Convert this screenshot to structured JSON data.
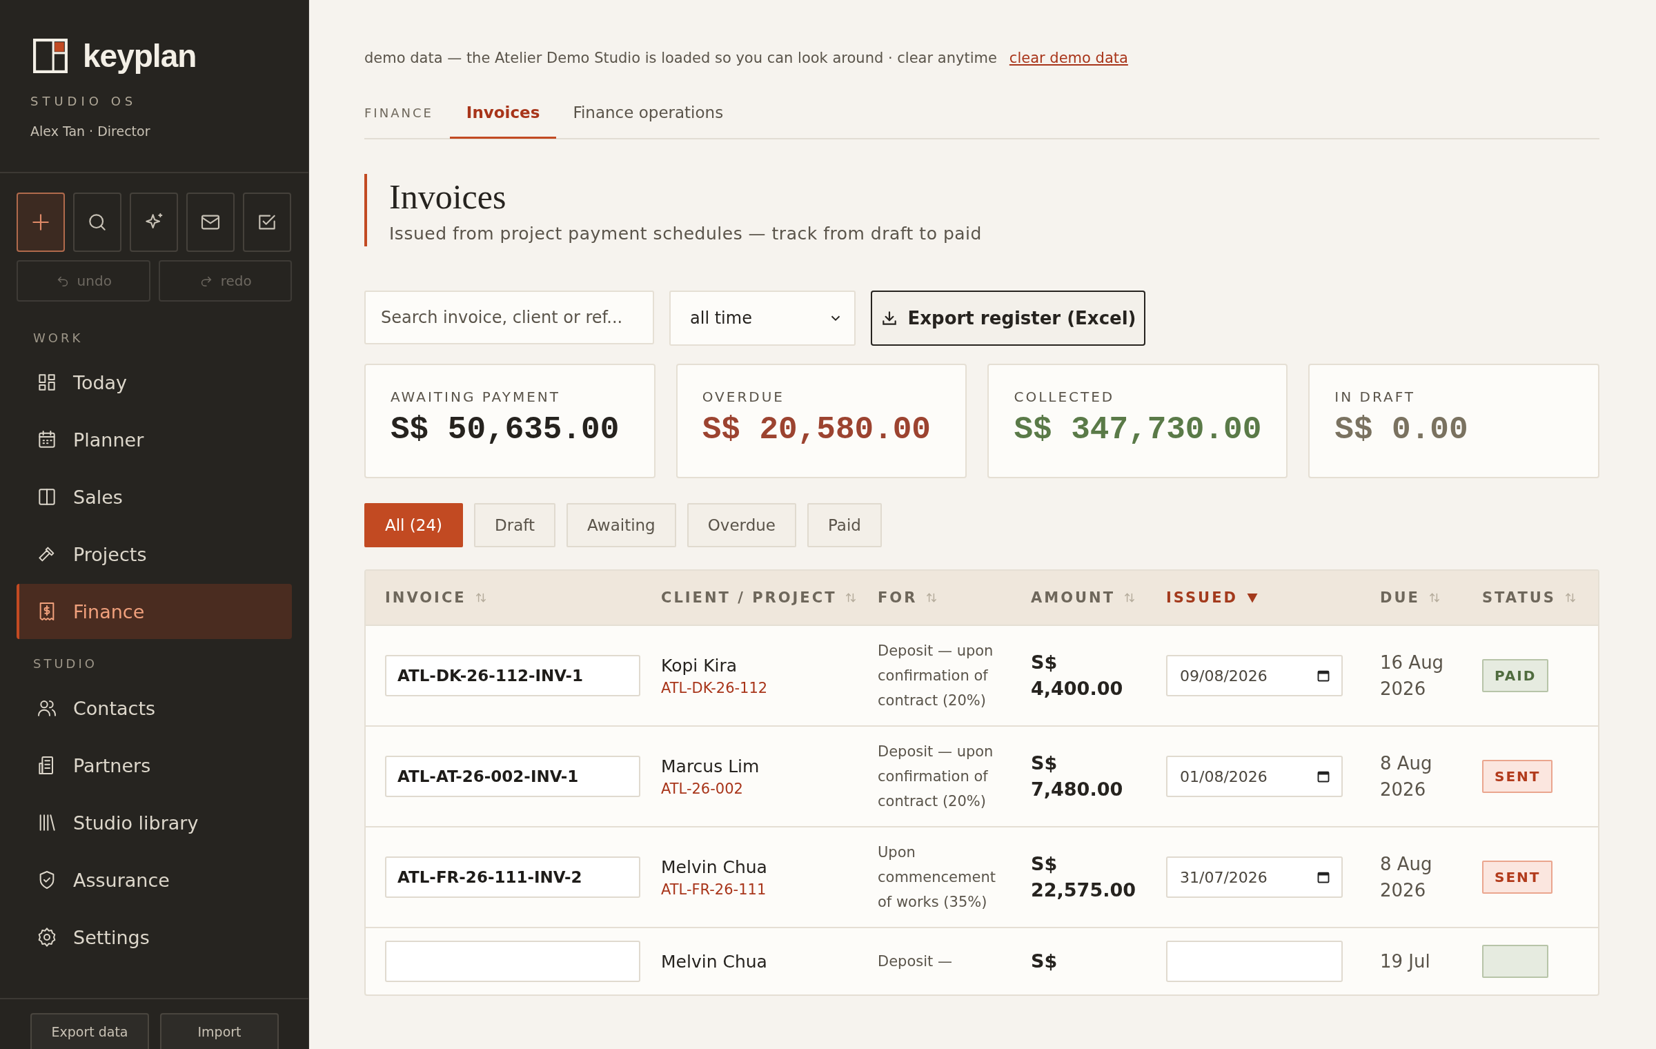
{
  "sidebar": {
    "brand": "keyplan",
    "tagline": "STUDIO OS",
    "user": "Alex Tan · Director",
    "quick_actions": [
      {
        "kind": "new",
        "selected": true
      },
      {
        "kind": "search",
        "selected": false
      },
      {
        "kind": "assistant",
        "selected": false
      },
      {
        "kind": "mail",
        "selected": false
      },
      {
        "kind": "tasks",
        "selected": false
      }
    ],
    "history": [
      {
        "kind": "undo",
        "label": "undo"
      },
      {
        "kind": "redo",
        "label": "redo"
      }
    ],
    "sections": [
      {
        "heading": "WORK",
        "items": [
          {
            "kind": "today",
            "label": "Today",
            "selected": false
          },
          {
            "kind": "planner",
            "label": "Planner",
            "selected": false
          },
          {
            "kind": "sales",
            "label": "Sales",
            "selected": false
          },
          {
            "kind": "projects",
            "label": "Projects",
            "selected": false
          },
          {
            "kind": "finance",
            "label": "Finance",
            "selected": true
          }
        ]
      },
      {
        "heading": "STUDIO",
        "items": [
          {
            "kind": "contacts",
            "label": "Contacts",
            "selected": false
          },
          {
            "kind": "partners",
            "label": "Partners",
            "selected": false
          },
          {
            "kind": "library",
            "label": "Studio library",
            "selected": false
          },
          {
            "kind": "assurance",
            "label": "Assurance",
            "selected": false
          },
          {
            "kind": "settings",
            "label": "Settings",
            "selected": false
          }
        ]
      }
    ],
    "footer_buttons": [
      "Export data",
      "Import"
    ]
  },
  "banner": {
    "text": "demo data — the Atelier Demo Studio is loaded so you can look around · clear anytime",
    "link": "clear demo data"
  },
  "breadcrumb": "FINANCE",
  "tabs": [
    {
      "label": "Invoices",
      "selected": true
    },
    {
      "label": "Finance operations",
      "selected": false
    }
  ],
  "page": {
    "title": "Invoices",
    "subtitle": "Issued from project payment schedules — track from draft to paid"
  },
  "search": {
    "placeholder": "Search invoice, client or ref..."
  },
  "period": {
    "value": "all time"
  },
  "export_button": "Export register (Excel)",
  "summary": [
    {
      "label": "AWAITING PAYMENT",
      "value": "S$ 50,635.00",
      "color": "#26231f"
    },
    {
      "label": "OVERDUE",
      "value": "S$ 20,580.00",
      "color": "#9c4330"
    },
    {
      "label": "COLLECTED",
      "value": "S$ 347,730.00",
      "color": "#5a7a48"
    },
    {
      "label": "IN DRAFT",
      "value": "S$ 0.00",
      "color": "#7a7260"
    }
  ],
  "filters": [
    {
      "label": "All (24)",
      "selected": true
    },
    {
      "label": "Draft",
      "selected": false
    },
    {
      "label": "Awaiting",
      "selected": false
    },
    {
      "label": "Overdue",
      "selected": false
    },
    {
      "label": "Paid",
      "selected": false
    }
  ],
  "table": {
    "columns": [
      {
        "label": "INVOICE",
        "sorted": false
      },
      {
        "label": "CLIENT / PROJECT",
        "sorted": false
      },
      {
        "label": "FOR",
        "sorted": false
      },
      {
        "label": "AMOUNT",
        "sorted": false
      },
      {
        "label": "ISSUED",
        "sorted": true
      },
      {
        "label": "DUE",
        "sorted": false
      },
      {
        "label": "STATUS",
        "sorted": false
      }
    ],
    "rows": [
      {
        "invoice": "ATL-DK-26-112-INV-1",
        "client": "Kopi Kira",
        "project": "ATL-DK-26-112",
        "for": "Deposit — upon confirmation of contract (20%)",
        "amount": "S$ 4,400.00",
        "issued": "09/08/2026",
        "due": "16 Aug 2026",
        "status": "PAID",
        "kind": "paid"
      },
      {
        "invoice": "ATL-AT-26-002-INV-1",
        "client": "Marcus Lim",
        "project": "ATL-26-002",
        "for": "Deposit — upon confirmation of contract (20%)",
        "amount": "S$ 7,480.00",
        "issued": "01/08/2026",
        "due": "8 Aug 2026",
        "status": "SENT",
        "kind": "sent"
      },
      {
        "invoice": "ATL-FR-26-111-INV-2",
        "client": "Melvin Chua",
        "project": "ATL-FR-26-111",
        "for": "Upon commencement of works (35%)",
        "amount": "S$ 22,575.00",
        "issued": "31/07/2026",
        "due": "8 Aug 2026",
        "status": "SENT",
        "kind": "sent"
      },
      {
        "client": "Melvin Chua",
        "for": "Deposit —",
        "amount": "S$",
        "due": "19 Jul",
        "kind": "paid"
      }
    ]
  }
}
